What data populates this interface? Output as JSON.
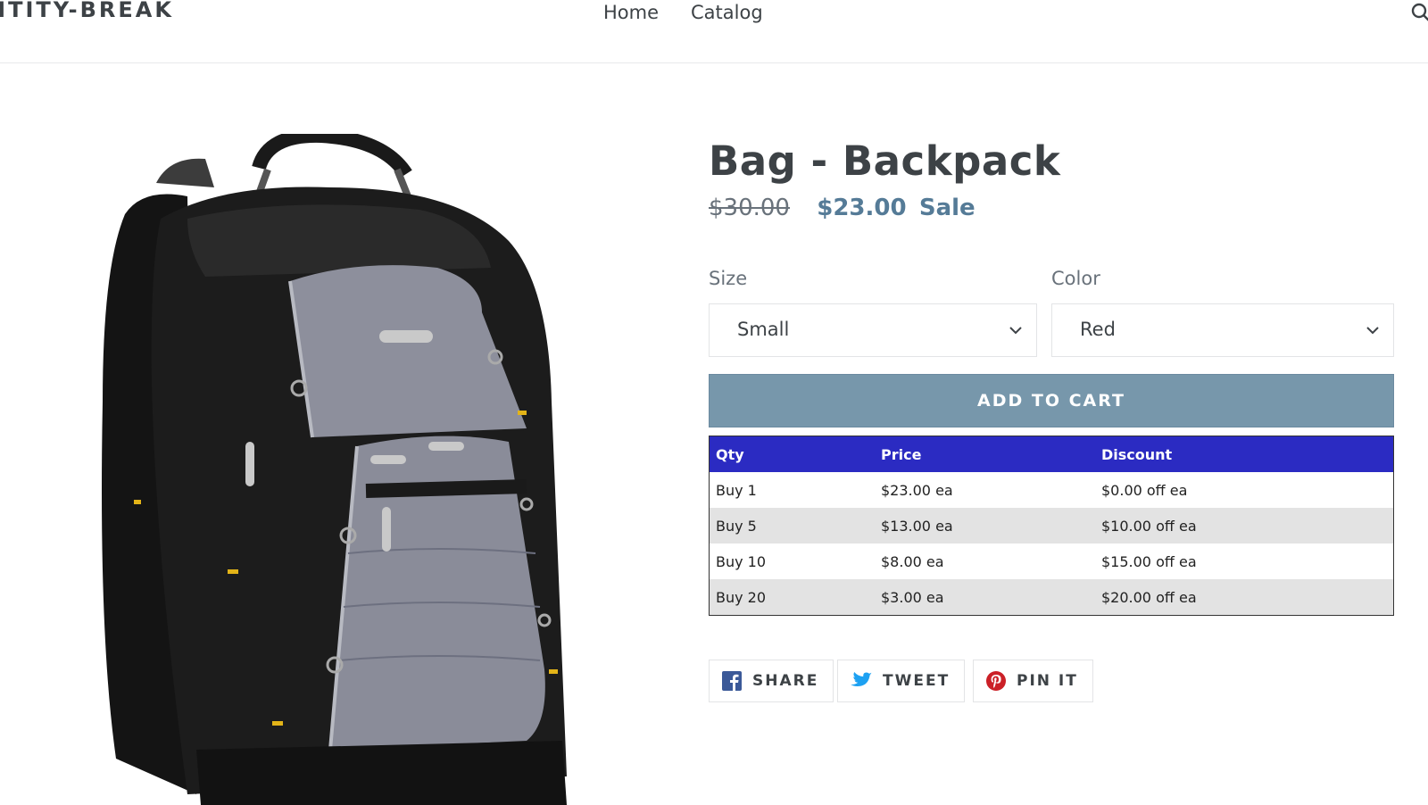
{
  "header": {
    "logo": "NTITY-BREAK",
    "nav": [
      {
        "label": "Home"
      },
      {
        "label": "Catalog"
      }
    ]
  },
  "product": {
    "title": "Bag - Backpack",
    "price_original": "$30.00",
    "price_sale": "$23.00",
    "sale_label": "Sale",
    "options": {
      "size_label": "Size",
      "size_value": "Small",
      "color_label": "Color",
      "color_value": "Red"
    },
    "add_to_cart": "ADD TO CART"
  },
  "discount_table": {
    "headers": [
      "Qty",
      "Price",
      "Discount"
    ],
    "rows": [
      [
        "Buy 1",
        "$23.00 ea",
        "$0.00 off ea"
      ],
      [
        "Buy 5",
        "$13.00 ea",
        "$10.00 off ea"
      ],
      [
        "Buy 10",
        "$8.00 ea",
        "$15.00 off ea"
      ],
      [
        "Buy 20",
        "$3.00 ea",
        "$20.00 off ea"
      ]
    ]
  },
  "social": {
    "share": "SHARE",
    "tweet": "TWEET",
    "pin": "PIN IT"
  },
  "colors": {
    "accent": "#557b97",
    "button": "#7797ab",
    "table_header": "#2b2bc2",
    "facebook": "#3b5998",
    "twitter": "#1da1f2",
    "pinterest": "#cb2027"
  },
  "icons": [
    "search-icon",
    "chevron-down-icon",
    "facebook-icon",
    "twitter-icon",
    "pinterest-icon"
  ]
}
